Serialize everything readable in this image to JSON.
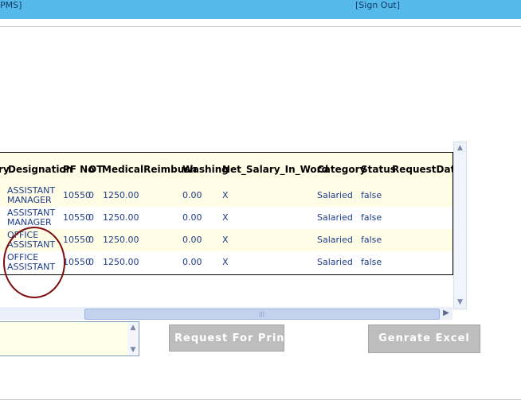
{
  "header": {
    "left_link": "PMS]",
    "sign_out": "[Sign Out]"
  },
  "grid": {
    "columns": {
      "partial_left": "ry",
      "designation": "Designation",
      "pf_no": "PF No",
      "ot": "OT",
      "medical": "MedicalReimbush",
      "washing": "Washing",
      "net_salary_in_word": "Net_Salary_In_Word",
      "category": "Category",
      "status": "Status",
      "request_date": "RequestDate"
    },
    "rows": [
      {
        "designation_1": "ASSISTANT",
        "designation_2": "MANAGER",
        "pf_no": "10550",
        "ot": "0",
        "medical": "1250.00",
        "washing": "0.00",
        "net_word": "X",
        "category": "Salaried",
        "status": "false"
      },
      {
        "designation_1": "ASSISTANT",
        "designation_2": "MANAGER",
        "pf_no": "10550",
        "ot": "0",
        "medical": "1250.00",
        "washing": "0.00",
        "net_word": "X",
        "category": "Salaried",
        "status": "false"
      },
      {
        "designation_1": "OFFICE",
        "designation_2": "ASSISTANT",
        "pf_no": "10550",
        "ot": "0",
        "medical": "1250.00",
        "washing": "0.00",
        "net_word": "X",
        "category": "Salaried",
        "status": "false"
      },
      {
        "designation_1": "OFFICE",
        "designation_2": "ASSISTANT",
        "pf_no": "10550",
        "ot": "0",
        "medical": "1250.00",
        "washing": "0.00",
        "net_word": "X",
        "category": "Salaried",
        "status": "false"
      }
    ]
  },
  "buttons": {
    "request_print": "Request For Print",
    "generate_excel": "Genrate Excel"
  },
  "icons": {
    "scroll_up": "chevron-up-icon",
    "scroll_down": "chevron-down-icon",
    "scroll_right": "chevron-right-icon"
  },
  "colors": {
    "header_bar": "#55b9ea",
    "row_alt": "#fffde6",
    "annotation_circle": "#7a0d0d",
    "button_gray": "#bdbdbd"
  }
}
